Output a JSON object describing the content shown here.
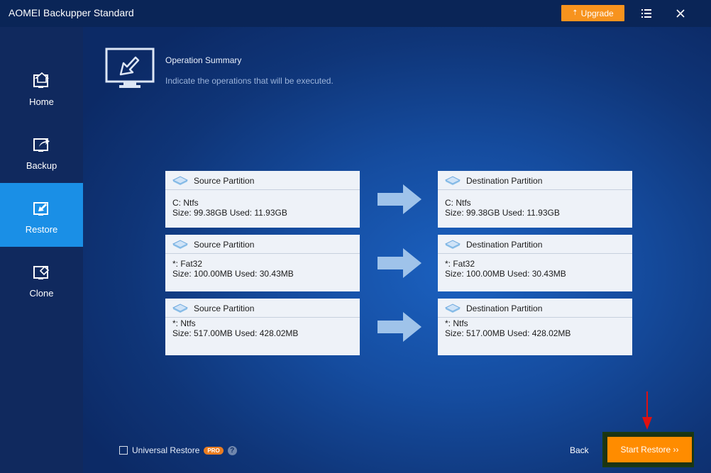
{
  "window": {
    "title": "AOMEI Backupper Standard"
  },
  "titlebar": {
    "upgrade_label": "Upgrade"
  },
  "sidebar": {
    "items": [
      {
        "label": "Home",
        "icon": "home-icon",
        "active": false
      },
      {
        "label": "Backup",
        "icon": "backup-icon",
        "active": false
      },
      {
        "label": "Restore",
        "icon": "restore-icon",
        "active": true
      },
      {
        "label": "Clone",
        "icon": "clone-icon",
        "active": false
      }
    ]
  },
  "summary": {
    "title": "Operation Summary",
    "subtitle": "Indicate the operations that will be executed."
  },
  "operations": [
    {
      "source": {
        "header": "Source Partition",
        "line1": "C: Ntfs",
        "line2": "Size: 99.38GB  Used: 11.93GB"
      },
      "destination": {
        "header": "Destination Partition",
        "line1": "C: Ntfs",
        "line2": "Size: 99.38GB  Used: 11.93GB"
      }
    },
    {
      "source": {
        "header": "Source Partition",
        "line1": "*: Fat32",
        "line2": "Size: 100.00MB  Used: 30.43MB"
      },
      "destination": {
        "header": "Destination Partition",
        "line1": "*: Fat32",
        "line2": "Size: 100.00MB  Used: 30.43MB"
      }
    },
    {
      "source": {
        "header": "Source Partition",
        "line1": "*: Ntfs",
        "line2": "Size: 517.00MB  Used: 428.02MB"
      },
      "destination": {
        "header": "Destination Partition",
        "line1": "*: Ntfs",
        "line2": "Size: 517.00MB  Used: 428.02MB"
      }
    }
  ],
  "footer": {
    "universal_restore_label": "Universal Restore",
    "pro_badge": "PRO",
    "help": "?",
    "back_label": "Back",
    "start_label": "Start Restore ››"
  },
  "colors": {
    "accent": "#1a8fe6",
    "upgrade": "#f7931e",
    "start": "#ff8c00",
    "titlebar": "#0a2557",
    "sidebar": "#10295e"
  }
}
